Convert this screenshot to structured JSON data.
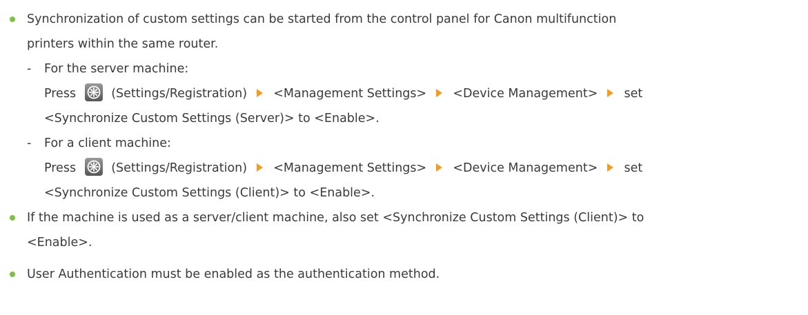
{
  "items": [
    {
      "lines": [
        "Synchronization of custom settings can be started from the control panel for Canon multifunction",
        "printers within the same router."
      ]
    },
    {
      "lines": [
        "If the machine is used as a server/client machine, also set <Synchronize Custom Settings (Client)> to",
        "<Enable>."
      ]
    },
    {
      "lines": [
        "User Authentication must be enabled as the authentication method."
      ]
    }
  ],
  "server": {
    "dash": "-",
    "heading": "For the server machine:",
    "press": "Press",
    "icon": "settings-registration-icon",
    "icon_label": "(Settings/Registration)",
    "step1": "<Management Settings>",
    "step2": "<Device Management>",
    "set": "set",
    "line3": "<Synchronize Custom Settings (Server)> to <Enable>."
  },
  "client": {
    "dash": "-",
    "heading": "For a client machine:",
    "press": "Press",
    "icon": "settings-registration-icon",
    "icon_label": "(Settings/Registration)",
    "step1": "<Management Settings>",
    "step2": "<Device Management>",
    "set": "set",
    "line3": "<Synchronize Custom Settings (Client)> to <Enable>."
  },
  "colors": {
    "bullet": "#7cc142",
    "arrow": "#f29d1e",
    "text": "#3a3a3a"
  }
}
